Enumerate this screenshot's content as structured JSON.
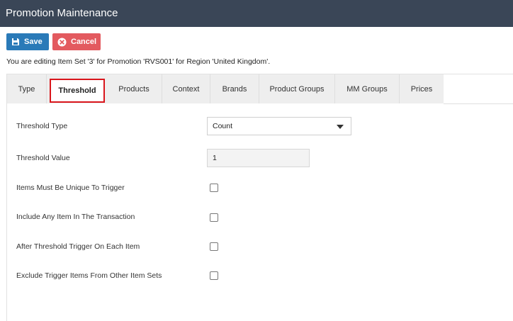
{
  "window": {
    "title": "Promotion Maintenance"
  },
  "toolbar": {
    "save_label": "Save",
    "cancel_label": "Cancel"
  },
  "info_text": "You are editing Item Set '3' for Promotion 'RVS001' for Region 'United Kingdom'.",
  "tabs": [
    {
      "label": "Type",
      "active": false
    },
    {
      "label": "Threshold",
      "active": true
    },
    {
      "label": "Products",
      "active": false
    },
    {
      "label": "Context",
      "active": false
    },
    {
      "label": "Brands",
      "active": false
    },
    {
      "label": "Product Groups",
      "active": false
    },
    {
      "label": "MM Groups",
      "active": false
    },
    {
      "label": "Prices",
      "active": false
    }
  ],
  "form": {
    "threshold_type": {
      "label": "Threshold Type",
      "value": "Count"
    },
    "threshold_value": {
      "label": "Threshold Value",
      "value": "1"
    },
    "unique": {
      "label": "Items Must Be Unique To Trigger",
      "checked": false
    },
    "include_any": {
      "label": "Include Any Item In The Transaction",
      "checked": false
    },
    "trigger_each": {
      "label": "After Threshold Trigger On Each Item",
      "checked": false
    },
    "exclude_trigger": {
      "label": "Exclude Trigger Items From Other Item Sets",
      "checked": false
    }
  },
  "colors": {
    "header": "#3a4657",
    "save": "#2a7ab8",
    "cancel": "#e35a5f",
    "active_tab_border": "#d9161c"
  }
}
